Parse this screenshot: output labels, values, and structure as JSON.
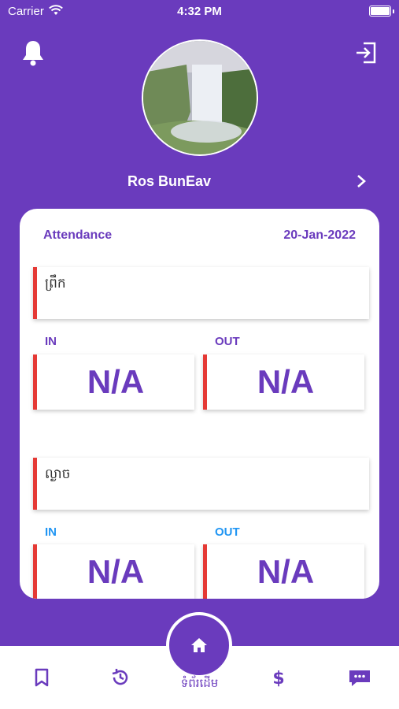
{
  "status_bar": {
    "carrier": "Carrier",
    "time": "4:32 PM"
  },
  "profile": {
    "name": "Ros BunEav"
  },
  "attendance": {
    "title": "Attendance",
    "date": "20-Jan-2022",
    "sessions": [
      {
        "name": "ព្រឹក",
        "in_label": "IN",
        "out_label": "OUT",
        "in_value": "N/A",
        "out_value": "N/A"
      },
      {
        "name": "ល្ងាច",
        "in_label": "IN",
        "out_label": "OUT",
        "in_value": "N/A",
        "out_value": "N/A"
      }
    ]
  },
  "colors": {
    "primary": "#6a3bbd",
    "accent_red": "#e53935",
    "label_purple": "#6a3bbd",
    "label_blue": "#2196f3"
  },
  "bottom_nav": {
    "home_label": "ទំព័រដើម"
  },
  "icons": [
    "wifi-icon",
    "battery-icon",
    "bell-icon",
    "logout-icon",
    "chevron-right-icon",
    "bookmark-icon",
    "history-icon",
    "dollar-icon",
    "message-icon",
    "home-icon"
  ]
}
